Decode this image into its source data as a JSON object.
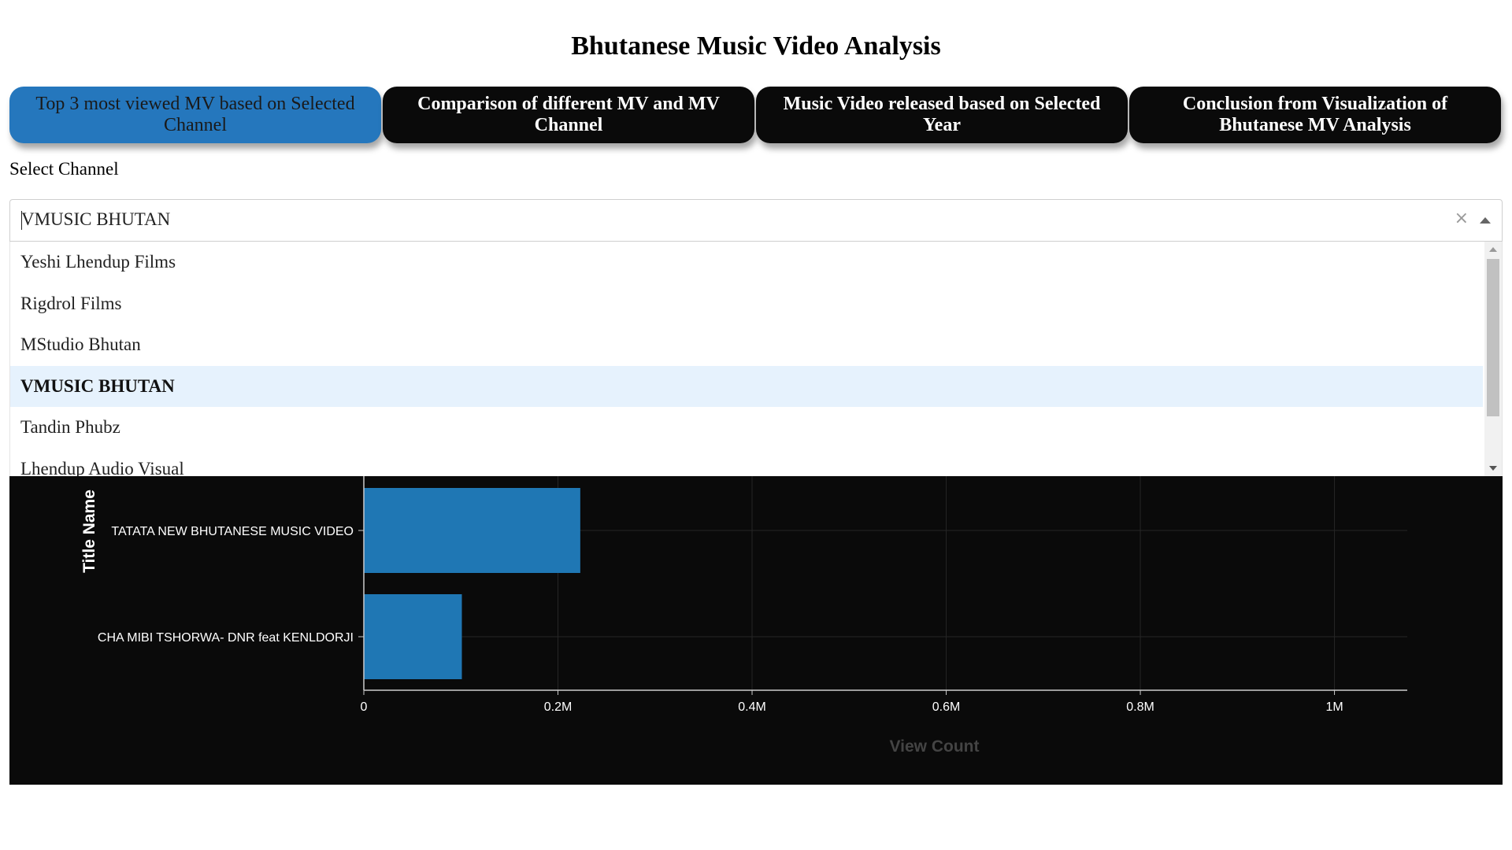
{
  "page": {
    "title": "Bhutanese Music Video Analysis"
  },
  "tabs": [
    {
      "label": "Top 3 most viewed MV based on Selected Channel",
      "active": true
    },
    {
      "label": "Comparison of different MV and MV Channel",
      "active": false
    },
    {
      "label": "Music Video released based on Selected Year",
      "active": false
    },
    {
      "label": "Conclusion from Visualization of Bhutanese MV Analysis",
      "active": false
    }
  ],
  "channel_select": {
    "label": "Select Channel",
    "value": "VMUSIC BHUTAN",
    "clear_icon": "×",
    "options": [
      {
        "label": "Yeshi Lhendup Films",
        "selected": false
      },
      {
        "label": "Rigdrol Films",
        "selected": false
      },
      {
        "label": "MStudio Bhutan",
        "selected": false
      },
      {
        "label": "VMUSIC BHUTAN",
        "selected": true
      },
      {
        "label": "Tandin Phubz",
        "selected": false
      },
      {
        "label": "Lhendup Audio Visual",
        "selected": false
      }
    ]
  },
  "chart_data": {
    "type": "bar",
    "orientation": "horizontal",
    "categories": [
      "TATATA NEW BHUTANESE MUSIC VIDEO",
      "CHA MIBI TSHORWA- DNR feat KENLDORJI"
    ],
    "values": [
      223000,
      101000
    ],
    "xlabel": "View Count",
    "ylabel": "Title Name",
    "xlim": [
      0,
      1075000
    ],
    "xticks": [
      0,
      200000,
      400000,
      600000,
      800000,
      1000000
    ],
    "xtick_labels": [
      "0",
      "0.2M",
      "0.4M",
      "0.6M",
      "0.8M",
      "1M"
    ],
    "grid": true,
    "bar_color": "#1f77b4",
    "background": "#0a0a0a"
  }
}
